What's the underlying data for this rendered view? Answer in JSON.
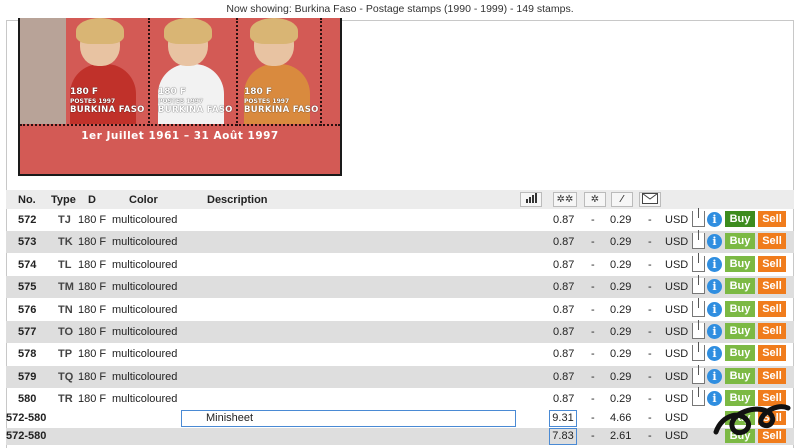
{
  "header": {
    "text": "Now showing: Burkina Faso - Postage stamps (1990 - 1999) - 149 stamps."
  },
  "sheet": {
    "stamps": [
      {
        "value": "180 F",
        "year": "POSTES 1997",
        "country": "BURKINA FASO",
        "dress_color": "#c0312a"
      },
      {
        "value": "180 F",
        "year": "POSTES 1997",
        "country": "BURKINA FASO",
        "dress_color": "#f2f2f2"
      },
      {
        "value": "180 F",
        "year": "POSTES 1997",
        "country": "BURKINA FASO",
        "dress_color": "#d98a3e"
      }
    ],
    "caption": "1er Juillet 1961 – 31 Août 1997"
  },
  "table": {
    "columns": {
      "no": "No.",
      "type": "Type",
      "d": "D",
      "color": "Color",
      "description": "Description"
    },
    "header_icons": [
      "bar-chart-icon",
      "mint-stamps-icon",
      "single-stamp-icon",
      "used-stamp-icon",
      "envelope-icon"
    ],
    "rows": [
      {
        "no": "572",
        "type": "TJ",
        "denom": "180 F",
        "color": "multicoloured",
        "v1": "0.87",
        "d1": "-",
        "v2": "0.29",
        "d2": "-",
        "currency": "USD",
        "buy": "Buy",
        "sell": "Sell"
      },
      {
        "no": "573",
        "type": "TK",
        "denom": "180 F",
        "color": "multicoloured",
        "v1": "0.87",
        "d1": "-",
        "v2": "0.29",
        "d2": "-",
        "currency": "USD",
        "buy": "Buy",
        "sell": "Sell"
      },
      {
        "no": "574",
        "type": "TL",
        "denom": "180 F",
        "color": "multicoloured",
        "v1": "0.87",
        "d1": "-",
        "v2": "0.29",
        "d2": "-",
        "currency": "USD",
        "buy": "Buy",
        "sell": "Sell"
      },
      {
        "no": "575",
        "type": "TM",
        "denom": "180 F",
        "color": "multicoloured",
        "v1": "0.87",
        "d1": "-",
        "v2": "0.29",
        "d2": "-",
        "currency": "USD",
        "buy": "Buy",
        "sell": "Sell"
      },
      {
        "no": "576",
        "type": "TN",
        "denom": "180 F",
        "color": "multicoloured",
        "v1": "0.87",
        "d1": "-",
        "v2": "0.29",
        "d2": "-",
        "currency": "USD",
        "buy": "Buy",
        "sell": "Sell"
      },
      {
        "no": "577",
        "type": "TO",
        "denom": "180 F",
        "color": "multicoloured",
        "v1": "0.87",
        "d1": "-",
        "v2": "0.29",
        "d2": "-",
        "currency": "USD",
        "buy": "Buy",
        "sell": "Sell"
      },
      {
        "no": "578",
        "type": "TP",
        "denom": "180 F",
        "color": "multicoloured",
        "v1": "0.87",
        "d1": "-",
        "v2": "0.29",
        "d2": "-",
        "currency": "USD",
        "buy": "Buy",
        "sell": "Sell"
      },
      {
        "no": "579",
        "type": "TQ",
        "denom": "180 F",
        "color": "multicoloured",
        "v1": "0.87",
        "d1": "-",
        "v2": "0.29",
        "d2": "-",
        "currency": "USD",
        "buy": "Buy",
        "sell": "Sell"
      },
      {
        "no": "580",
        "type": "TR",
        "denom": "180 F",
        "color": "multicoloured",
        "v1": "0.87",
        "d1": "-",
        "v2": "0.29",
        "d2": "-",
        "currency": "USD",
        "buy": "Buy",
        "sell": "Sell"
      }
    ],
    "minisheets": [
      {
        "no": "572-580",
        "description": "Minisheet",
        "v1": "9.31",
        "d1": "-",
        "v2": "4.66",
        "d2": "-",
        "currency": "USD",
        "buy": "Buy",
        "sell": "Sell"
      },
      {
        "no": "572-580",
        "description": "",
        "v1": "7.83",
        "d1": "-",
        "v2": "2.61",
        "d2": "-",
        "currency": "USD",
        "buy": "Buy",
        "sell": "Sell"
      }
    ]
  },
  "colors": {
    "buy": "#7cb944",
    "buy_active": "#3d8c1e",
    "sell": "#f07c1c",
    "info": "#2f8ee0",
    "row_alt": "#dedede"
  }
}
